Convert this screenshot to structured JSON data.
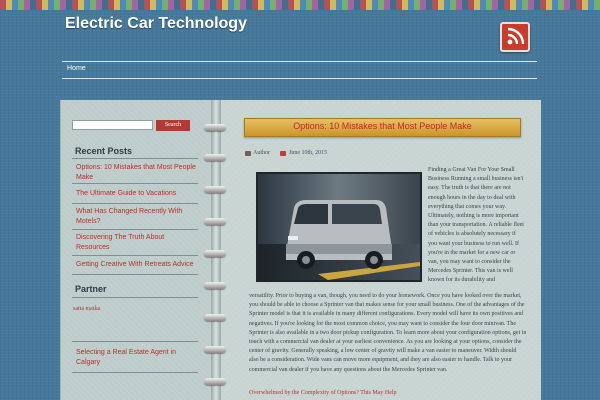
{
  "site": {
    "title": "Electric Car Technology"
  },
  "nav": {
    "home": "Home"
  },
  "sidebar": {
    "search_button": "Search",
    "recent_title": "Recent Posts",
    "recent_posts": [
      "Options: 10 Mistakes that Most People Make",
      "The Ultimate Guide to Vacations",
      "What Has Changed Recently With Motels?",
      "Discovering The Truth About Resources",
      "Getting Creative With Retreats Advice"
    ],
    "partner_title": "Partner",
    "partner_link": "satta matka",
    "extra_link": "Selecting a Real Estate Agent in Calgary"
  },
  "post": {
    "title": "Options: 10 Mistakes that Most People Make",
    "author": "Author",
    "date": "June 10th, 2015",
    "column_text": "Finding a Great Van For Your Small Business Running a small business isn't easy. The truth is that there are not enough hours in the day to deal with everything that comes your way. Ultimately, nothing is more important than your transportation. A reliable fleet of vehicles is absolutely necessary if you want your business to run well. If you're in the market for a new car or van, you may want to consider the Mercedes Sprinter. This van is well known for its durability and",
    "full_text": "versatility. Prior to buying a van, though, you need to do your homework. Once you have looked over the market, you should be able to choose a Sprinter van that makes sense for your small business. One of the advantages of the Sprinter model is that it is available in many different configurations. Every model will have its own positives and negatives. If you're looking for the most common choice, you may want to consider the four door minivan. The Sprinter is also available in a two door pickup configuration. To learn more about your configuration options, get in touch with a commercial van dealer at your earliest convenience. As you are looking at your options, consider the center of gravity. Generally speaking, a low center of gravity will make a van easier to maneuver. Width should also be a consideration. Wide vans can move more equipment, and they are also easier to handle. Talk to your commercial van dealer if you have any questions about the Mercedes Sprinter van.",
    "continue_link": "Overwhelmed by the Complexity of Options? This May Help"
  }
}
